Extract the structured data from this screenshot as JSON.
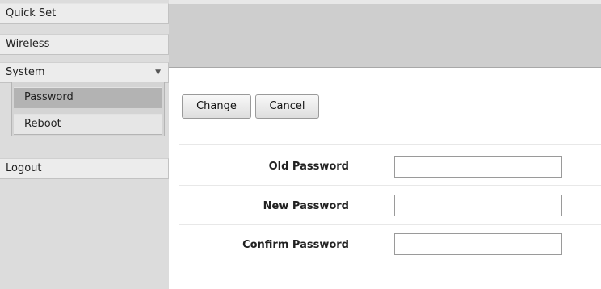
{
  "sidebar": {
    "items": [
      {
        "label": "Quick Set"
      },
      {
        "label": "Wireless"
      },
      {
        "label": "System",
        "expand_icon": "▼"
      }
    ],
    "submenu": [
      {
        "label": "Password",
        "active": true
      },
      {
        "label": "Reboot"
      }
    ],
    "logout_label": "Logout"
  },
  "toolbar": {
    "change_label": "Change",
    "cancel_label": "Cancel"
  },
  "form": {
    "fields": [
      {
        "label": "Old Password",
        "value": ""
      },
      {
        "label": "New Password",
        "value": ""
      },
      {
        "label": "Confirm Password",
        "value": ""
      }
    ]
  },
  "icons": {
    "system_expand": "chevron-down-icon"
  },
  "colors": {
    "sidebar_bg": "#dcdcdc",
    "header_bg": "#cecece",
    "active_item_bg": "#b3b3b3"
  }
}
